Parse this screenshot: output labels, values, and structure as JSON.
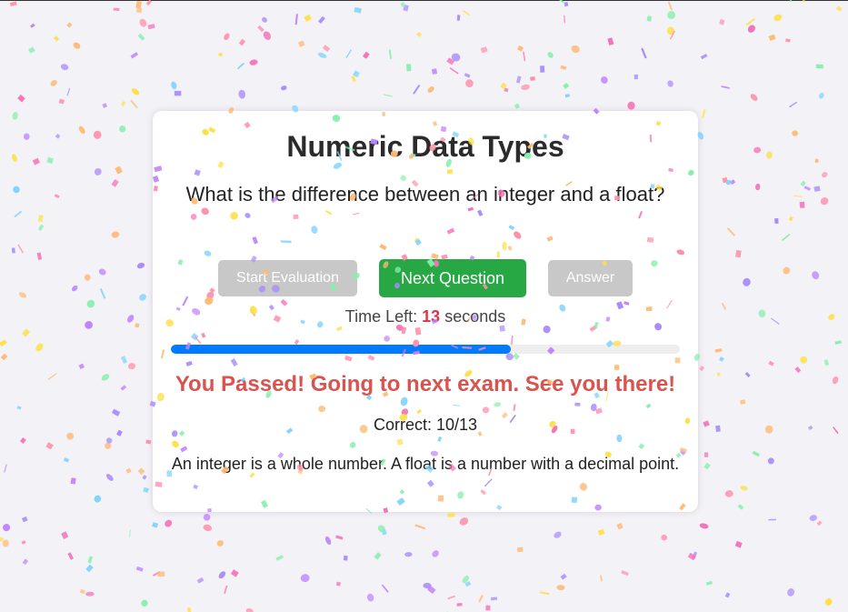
{
  "quiz": {
    "title": "Numeric Data Types",
    "question": "What is the difference between an integer and a float?",
    "buttons": {
      "start": "Start Evaluation",
      "next": "Next Question",
      "answer": "Answer"
    },
    "timer": {
      "prefix": "Time Left:",
      "seconds_value": "13",
      "suffix": "seconds"
    },
    "progress_fraction": 0.667,
    "result_message": "You Passed! Going to next exam. See you there!",
    "score": "Correct: 10/13",
    "explanation": "An integer is a whole number. A float is a number with a decimal point."
  },
  "colors": {
    "next_button": "#28a745",
    "disabled_button": "#c8c8c8",
    "progress": "#007bff",
    "result": "#d9534f",
    "timer_value": "#dc3545",
    "confetti": [
      "#ff8fab",
      "#a78bfa",
      "#fde047",
      "#86efac",
      "#7dd3fc",
      "#f472b6",
      "#fdba74",
      "#c084fc"
    ]
  }
}
